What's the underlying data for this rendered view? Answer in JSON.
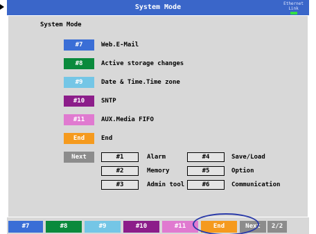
{
  "window": {
    "title": "System Mode",
    "ethernet_line1": "Ethernet",
    "ethernet_line2": "Link",
    "accent": "#3a66c9",
    "link_led_color": "#33dd44"
  },
  "panel": {
    "section_title": "System Mode"
  },
  "menu": [
    {
      "key": "#7",
      "label": "Web.E-Mail",
      "color": "#3a6ed6"
    },
    {
      "key": "#8",
      "label": "Active storage changes",
      "color": "#0a8a3c"
    },
    {
      "key": "#9",
      "label": "Date & Time.Time zone",
      "color": "#74c6e6"
    },
    {
      "key": "#10",
      "label": "SNTP",
      "color": "#8c1d8a"
    },
    {
      "key": "#11",
      "label": "AUX.Media FIFO",
      "color": "#e07ad0"
    },
    {
      "key": "End",
      "label": "End",
      "color": "#f59a1e"
    }
  ],
  "next": {
    "key": "Next",
    "color": "#8c8c8c",
    "items": [
      {
        "key": "#1",
        "label": "Alarm"
      },
      {
        "key": "#2",
        "label": "Memory"
      },
      {
        "key": "#3",
        "label": "Admin tool"
      },
      {
        "key": "#4",
        "label": "Save/Load"
      },
      {
        "key": "#5",
        "label": "Option"
      },
      {
        "key": "#6",
        "label": "Communication"
      }
    ]
  },
  "softkeys": [
    {
      "label": "#7"
    },
    {
      "label": "#8"
    },
    {
      "label": "#9"
    },
    {
      "label": "#10"
    },
    {
      "label": "#11"
    },
    {
      "label": "End"
    },
    {
      "label": "Next"
    }
  ],
  "page_indicator": "2/2"
}
